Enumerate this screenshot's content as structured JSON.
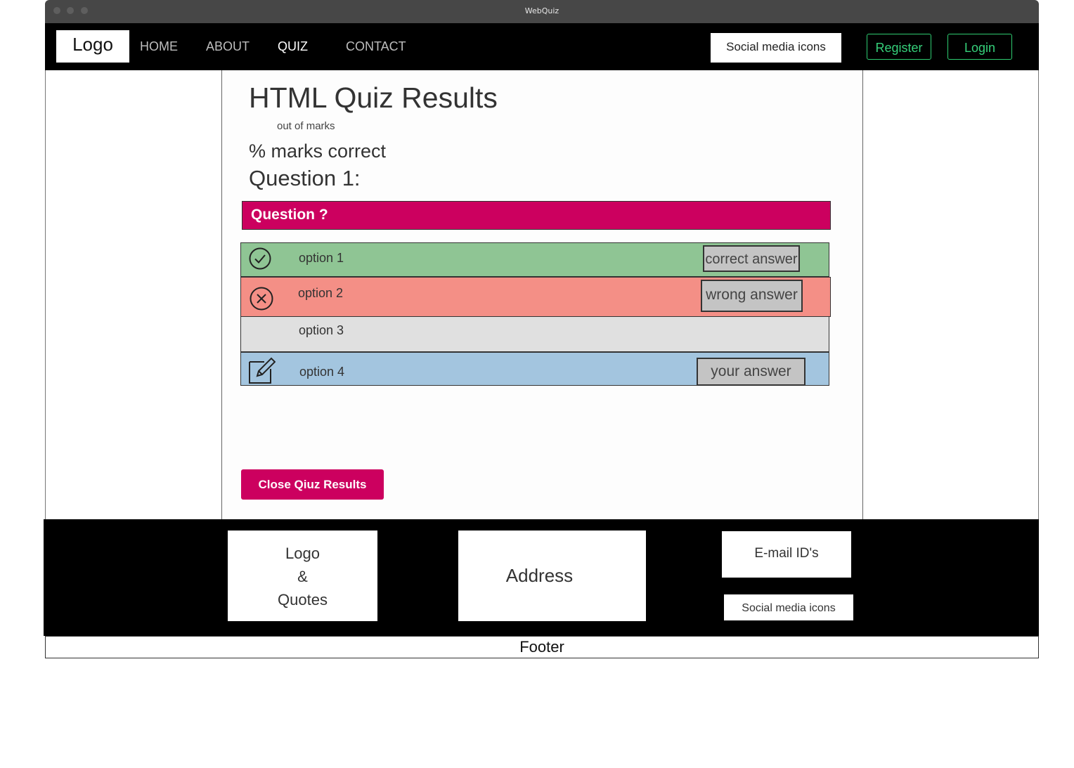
{
  "window": {
    "title": "WebQuiz"
  },
  "navbar": {
    "logo": "Logo",
    "links": [
      "HOME",
      "ABOUT",
      "QUIZ",
      "CONTACT"
    ],
    "active_link": "QUIZ",
    "social": "Social media icons",
    "register": "Register",
    "login": "Login",
    "accent_color": "#2ecc71"
  },
  "results": {
    "title": "HTML Quiz Results",
    "score_line": "out of marks",
    "percent_line": "% marks correct",
    "question_number": "Question 1:",
    "question_text": "Question ?",
    "question_color": "#cc005f",
    "options": [
      {
        "label": "option 1",
        "tag": "correct answer",
        "icon": "check-circle-icon",
        "color": "#8fc594"
      },
      {
        "label": "option 2",
        "tag": "wrong answer",
        "icon": "x-circle-icon",
        "color": "#f48f86"
      },
      {
        "label": "option 3",
        "tag": "",
        "icon": "",
        "color": "#e0e0e0"
      },
      {
        "label": "option 4",
        "tag": "your answer",
        "icon": "edit-icon",
        "color": "#a3c5df"
      }
    ],
    "close_button": "Close Qiuz Results"
  },
  "footer": {
    "logo_quotes": [
      "Logo",
      "&",
      "Quotes"
    ],
    "address": "Address",
    "emails": "E-mail ID's",
    "social": "Social media icons",
    "label": "Footer"
  }
}
